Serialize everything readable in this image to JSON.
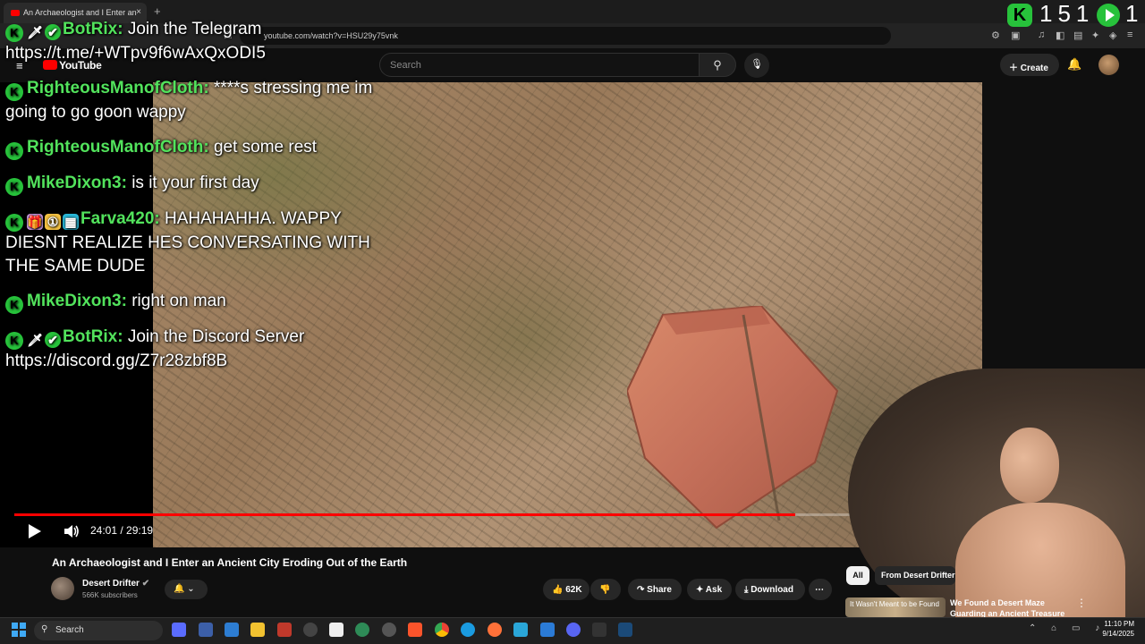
{
  "browser": {
    "tab_title": "An Archaeologist and I Enter an",
    "tab_close": "×",
    "new_tab": "+",
    "url": "youtube.com/watch?v=HSU29y75vnk"
  },
  "youtube": {
    "logo": "YouTube",
    "search_placeholder": "Search",
    "create_label": "Create"
  },
  "stream_overlay": {
    "viewer_count": "151",
    "follower_count": "1",
    "chat": [
      {
        "user": "BotRix:",
        "text": "Join the Telegram https://t.me/+WTpv9f6wAxQxODI5",
        "badges": [
          "kick",
          "sword",
          "verified"
        ]
      },
      {
        "user": "RighteousManofCloth:",
        "text": "****s stressing me im going to go goon wappy",
        "badges": [
          "kick"
        ]
      },
      {
        "user": "RighteousManofCloth:",
        "text": "get some rest",
        "badges": [
          "kick"
        ]
      },
      {
        "user": "MikeDixon3:",
        "text": "is it your first day",
        "badges": [
          "kick"
        ]
      },
      {
        "user": "Farva420:",
        "text": "HAHAHAHHA. WAPPY DIESNT REALIZE HES CONVERSATING WITH THE SAME DUDE",
        "badges": [
          "kick",
          "gift",
          "medal",
          "sub"
        ]
      },
      {
        "user": "MikeDixon3:",
        "text": "right on man",
        "badges": [
          "kick"
        ]
      },
      {
        "user": "BotRix:",
        "text": "Join the Discord Server https://discord.gg/Z7r28zbf8B",
        "badges": [
          "kick",
          "sword",
          "verified"
        ]
      }
    ]
  },
  "player": {
    "time": "24:01 / 29:19",
    "progress_fraction": 0.819
  },
  "video_info": {
    "title": "An Archaeologist and I Enter an Ancient City Eroding Out of the Earth",
    "channel": "Desert Drifter",
    "subscribers": "566K subscribers",
    "likes": "62K",
    "share": "Share",
    "ask": "Ask",
    "download": "Download"
  },
  "sidebar": {
    "chip_all": "All",
    "chip_from": "From Desert Drifter",
    "rec_thumb_text": "It Wasn't Meant to be Found",
    "rec_title": "We Found a Desert Maze Guarding an Ancient Treasure"
  },
  "taskbar": {
    "search": "Search",
    "time": "11:10 PM",
    "date": "9/14/2025"
  },
  "colors": {
    "kick_green": "#27c23b",
    "username_green": "#52e35c",
    "progress_red": "#ff0000"
  }
}
